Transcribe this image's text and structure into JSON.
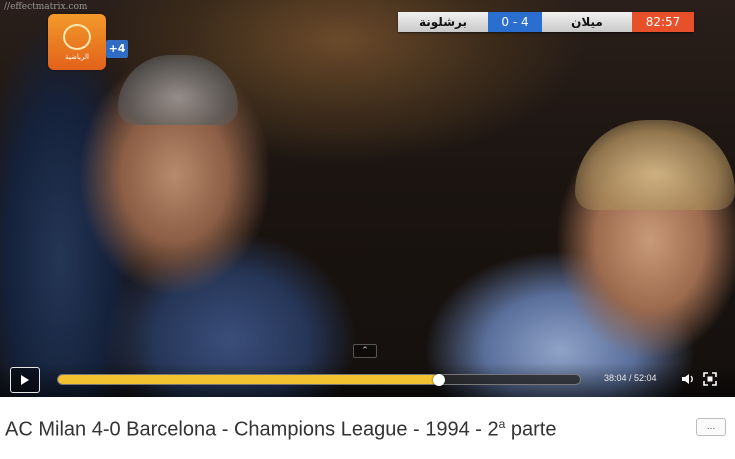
{
  "overlay": {
    "watermark": "//effectmatrix.com",
    "channel_text": "الرياضية",
    "channel_plus": "+4"
  },
  "scoreboard": {
    "team_home": "ميلان",
    "score": "0 - 4",
    "team_away": "برشلونة",
    "match_time": "82:57"
  },
  "player": {
    "progress_fraction": 0.7303,
    "time_label": "38:04 / 52:04",
    "accent_color": "#f2c230"
  },
  "video": {
    "title_main": "AC Milan 4-0 Barcelona - Champions League - 1994 - 2",
    "title_sup": "a",
    "title_tail": " parte",
    "more_label": "..."
  },
  "icons": {
    "play": "play-icon",
    "volume": "volume-icon",
    "fullscreen": "fullscreen-icon",
    "expand": "chevron-up-icon"
  }
}
